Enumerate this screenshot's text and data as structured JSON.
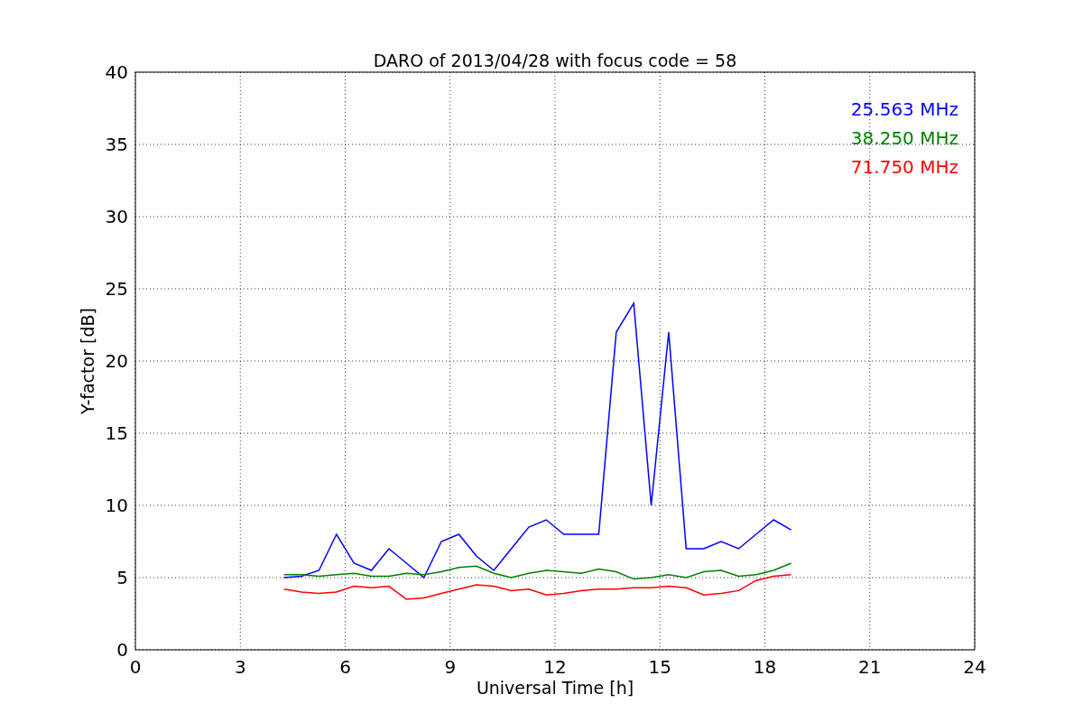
{
  "chart_data": {
    "type": "line",
    "title": "DARO of 2013/04/28 with focus code = 58",
    "xlabel": "Universal Time [h]",
    "ylabel": "Y-factor [dB]",
    "x": [
      4.25,
      4.75,
      5.25,
      5.75,
      6.25,
      6.75,
      7.25,
      7.75,
      8.25,
      8.75,
      9.25,
      9.75,
      10.25,
      10.75,
      11.25,
      11.75,
      12.25,
      12.75,
      13.25,
      13.75,
      14.25,
      14.75,
      15.25,
      15.75,
      16.25,
      16.75,
      17.25,
      17.75,
      18.25,
      18.75
    ],
    "series": [
      {
        "name": "25.563 MHz",
        "color": "#0000ff",
        "values": [
          5,
          5.1,
          5.5,
          8,
          6,
          5.5,
          7,
          6,
          5,
          7.5,
          8,
          6.5,
          5.5,
          7,
          8.5,
          9,
          8,
          8,
          8,
          22,
          24,
          10,
          22,
          7,
          7,
          7.5,
          7,
          8,
          9,
          8.3
        ]
      },
      {
        "name": "38.250 MHz",
        "color": "#008000",
        "values": [
          5.2,
          5.2,
          5.1,
          5.2,
          5.3,
          5.1,
          5.1,
          5.3,
          5.2,
          5.4,
          5.7,
          5.8,
          5.3,
          5,
          5.3,
          5.5,
          5.4,
          5.3,
          5.6,
          5.4,
          4.9,
          5,
          5.2,
          5,
          5.4,
          5.5,
          5.1,
          5.2,
          5.5,
          6
        ]
      },
      {
        "name": "71.750 MHz",
        "color": "#ff0000",
        "values": [
          4.2,
          4,
          3.9,
          4,
          4.4,
          4.3,
          4.4,
          3.5,
          3.6,
          3.9,
          4.2,
          4.5,
          4.4,
          4.1,
          4.2,
          3.8,
          3.9,
          4.1,
          4.2,
          4.2,
          4.3,
          4.3,
          4.4,
          4.3,
          3.8,
          3.9,
          4.1,
          4.8,
          5.1,
          5.2
        ]
      }
    ],
    "xlim": [
      0,
      24
    ],
    "ylim": [
      0,
      40
    ],
    "xticks": [
      0,
      3,
      6,
      9,
      12,
      15,
      18,
      21,
      24
    ],
    "yticks": [
      0,
      5,
      10,
      15,
      20,
      25,
      30,
      35,
      40
    ],
    "grid": true
  }
}
